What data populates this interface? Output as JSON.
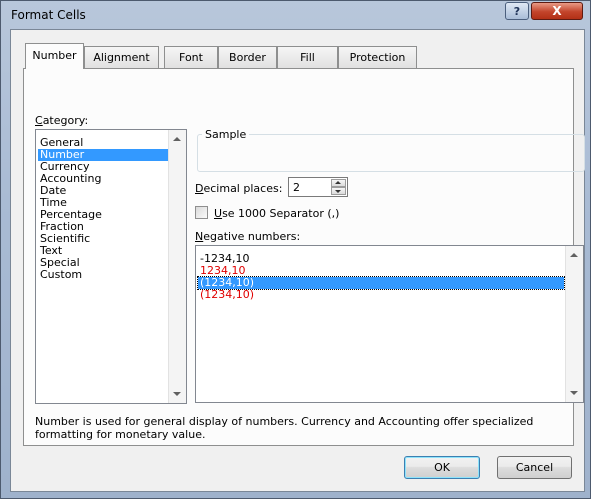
{
  "window": {
    "title": "Format Cells",
    "help_glyph": "?",
    "close_glyph": "X"
  },
  "tabs": [
    "Number",
    "Alignment",
    "Font",
    "Border",
    "Fill",
    "Protection"
  ],
  "active_tab": "Number",
  "category": {
    "label_u": "C",
    "label_rest": "ategory:",
    "items": [
      "General",
      "Number",
      "Currency",
      "Accounting",
      "Date",
      "Time",
      "Percentage",
      "Fraction",
      "Scientific",
      "Text",
      "Special",
      "Custom"
    ],
    "selected": "Number"
  },
  "sample": {
    "label": "Sample",
    "value": ""
  },
  "decimal": {
    "label_u": "D",
    "label_rest": "ecimal places:",
    "value": "2"
  },
  "separator": {
    "label_u": "U",
    "label_rest": "se 1000 Separator (,)",
    "checked": false
  },
  "negative": {
    "label_u": "N",
    "label_rest": "egative numbers:",
    "items": [
      {
        "text": "-1234,10",
        "color": "#000000"
      },
      {
        "text": "1234,10",
        "color": "#e00000"
      },
      {
        "text": "(1234,10)",
        "color": "#ffffff"
      },
      {
        "text": "(1234,10)",
        "color": "#e00000"
      }
    ],
    "selected_index": 2
  },
  "description": "Number is used for general display of numbers.  Currency and Accounting offer specialized formatting for monetary value.",
  "buttons": {
    "ok": "OK",
    "cancel": "Cancel"
  }
}
